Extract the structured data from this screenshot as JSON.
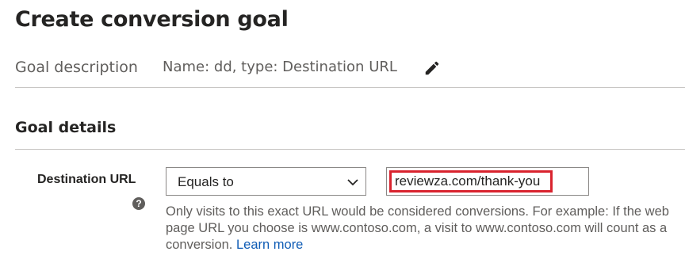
{
  "page": {
    "title": "Create conversion goal"
  },
  "goal_description": {
    "label": "Goal description",
    "value": "Name: dd, type: Destination URL",
    "edit_icon": "pencil-icon"
  },
  "goal_details": {
    "title": "Goal details",
    "destination_url": {
      "label": "Destination URL",
      "help_icon": "question-circle-icon",
      "help_glyph": "?",
      "operator": {
        "selected": "Equals to",
        "icon": "chevron-down-icon"
      },
      "url_value": "reviewza.com/thank-you",
      "help_text": "Only visits to this exact URL would be considered conversions. For example: If the web page URL you choose is www.contoso.com, a visit to www.contoso.com will count as a conversion.",
      "learn_more": "Learn more"
    }
  },
  "colors": {
    "highlight_border": "#d9232e",
    "link": "#0f5cb5",
    "muted_text": "#605e5c",
    "divider": "#c8c6c4"
  }
}
